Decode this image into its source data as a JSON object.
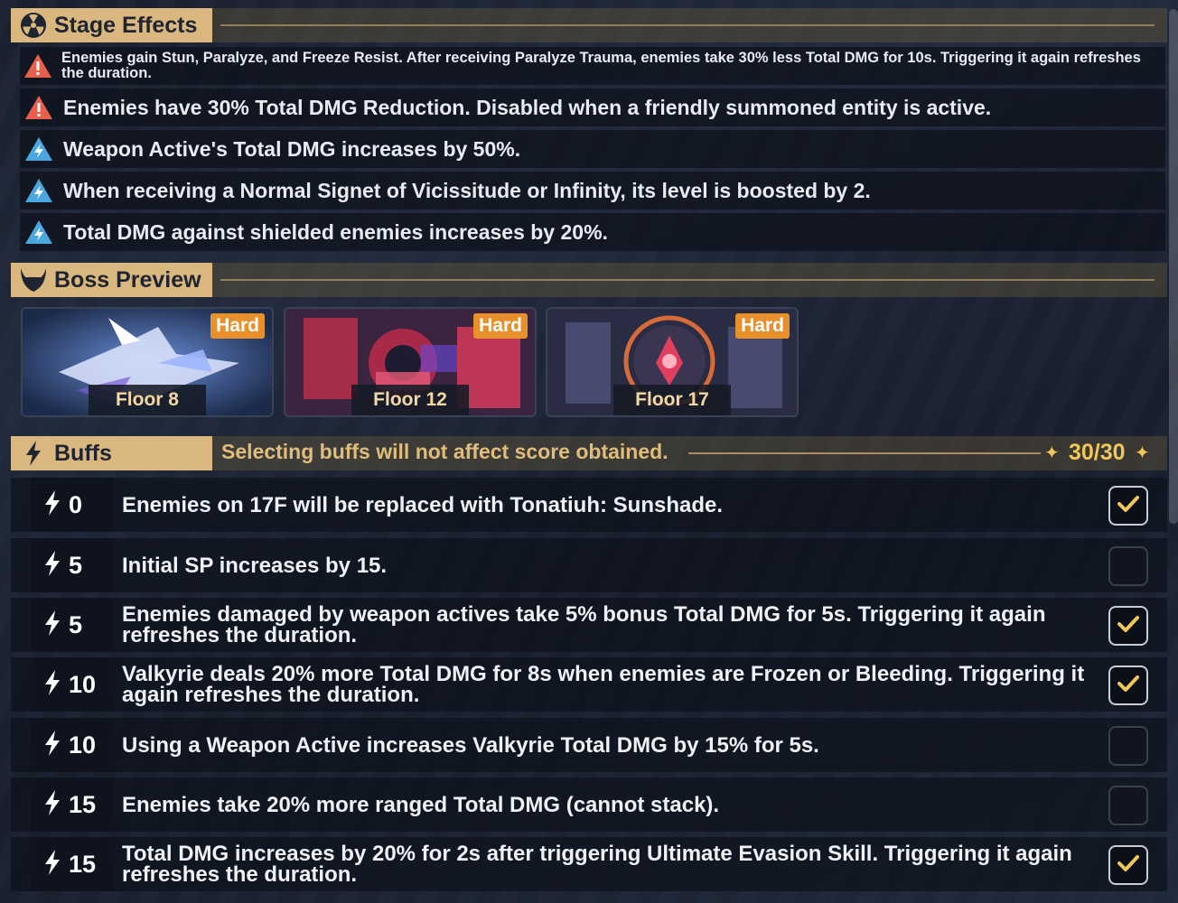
{
  "stage_effects": {
    "title": "Stage Effects",
    "items": [
      {
        "type": "warning",
        "text": "Enemies gain Stun, Paralyze, and Freeze Resist. After receiving Paralyze Trauma, enemies take 30% less Total DMG for 10s. Triggering it again refreshes the duration."
      },
      {
        "type": "warning",
        "text": "Enemies have 30% Total DMG Reduction. Disabled when a friendly summoned entity is active."
      },
      {
        "type": "bonus",
        "text": "Weapon Active's Total DMG increases by 50%."
      },
      {
        "type": "bonus",
        "text": "When receiving a Normal Signet of Vicissitude or Infinity, its level is boosted by 2."
      },
      {
        "type": "bonus",
        "text": "Total DMG against shielded enemies increases by 20%."
      }
    ]
  },
  "boss_preview": {
    "title": "Boss Preview",
    "bosses": [
      {
        "floor": "Floor 8",
        "difficulty": "Hard",
        "icon": "shark-mecha-art"
      },
      {
        "floor": "Floor 12",
        "difficulty": "Hard",
        "icon": "red-mecha-art"
      },
      {
        "floor": "Floor 17",
        "difficulty": "Hard",
        "icon": "ring-construct-art"
      }
    ]
  },
  "buffs": {
    "title": "Buffs",
    "note": "Selecting buffs will not affect score obtained.",
    "points": "30/30",
    "items": [
      {
        "cost": "0",
        "text": "Enemies on 17F will be replaced with Tonatiuh: Sunshade.",
        "checked": true
      },
      {
        "cost": "5",
        "text": "Initial SP increases by 15.",
        "checked": false
      },
      {
        "cost": "5",
        "text": "Enemies damaged by weapon actives take 5% bonus Total DMG for 5s. Triggering it again refreshes the duration.",
        "checked": true
      },
      {
        "cost": "10",
        "text": "Valkyrie deals 20% more Total DMG for 8s when enemies are Frozen or Bleeding. Triggering it again refreshes the duration.",
        "checked": true
      },
      {
        "cost": "10",
        "text": "Using a Weapon Active increases Valkyrie Total DMG by 15% for 5s.",
        "checked": false
      },
      {
        "cost": "15",
        "text": "Enemies take 20% more ranged Total DMG (cannot stack).",
        "checked": false
      },
      {
        "cost": "15",
        "text": "Total DMG increases by 20% for 2s after triggering Ultimate Evasion Skill. Triggering it again refreshes the duration.",
        "checked": true
      }
    ]
  },
  "colors": {
    "accent": "#d9b77e",
    "hard": "#e8912c",
    "warning": "#e8604c",
    "bonus": "#4aa7e0"
  }
}
